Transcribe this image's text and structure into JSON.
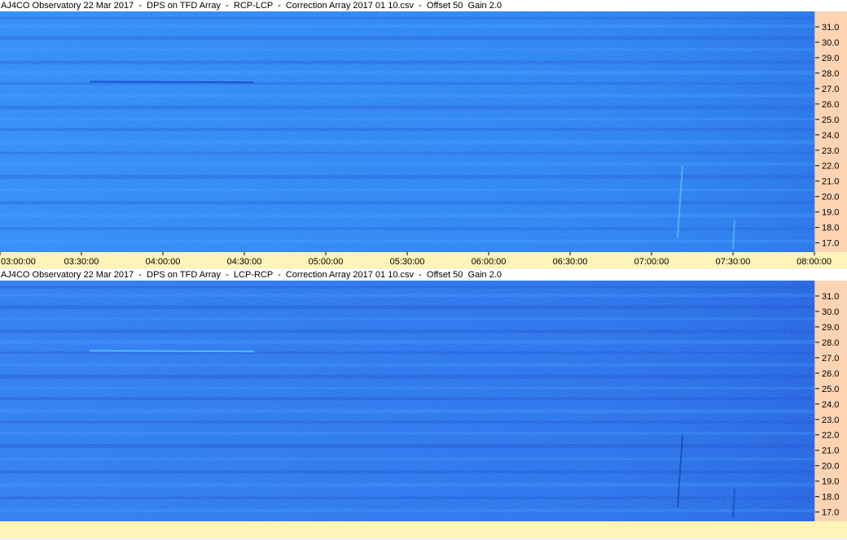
{
  "panels": [
    {
      "title": "AJ4CO Observatory 22 Mar 2017  -  DPS on TFD Array  -  RCP-LCP  -  Correction Array 2017 01 10.csv  -  Offset 50  Gain 2.0",
      "colors": {
        "base": "#1f74ee",
        "light": "#3da2ff",
        "dark": "#1650d6"
      }
    },
    {
      "title": "AJ4CO Observatory 22 Mar 2017  -  DPS on TFD Array  -  LCP-RCP  -  Correction Array 2017 01 10.csv  -  Offset 50  Gain 2.0",
      "colors": {
        "base": "#1c5fe6",
        "light": "#3a98ff",
        "dark": "#1442c8"
      }
    }
  ],
  "chart_data": [
    {
      "type": "heatmap",
      "title": "AJ4CO Observatory 22 Mar 2017  -  DPS on TFD Array  -  RCP-LCP  -  Correction Array 2017 01 10.csv  -  Offset 50  Gain 2.0",
      "xlabel": "",
      "ylabel": "",
      "x_ticks": [
        "03:00:00",
        "03:30:00",
        "04:00:00",
        "04:30:00",
        "05:00:00",
        "05:30:00",
        "06:00:00",
        "06:30:00",
        "07:00:00",
        "07:30:00",
        "08:00:00"
      ],
      "y_ticks": [
        "31.0",
        "30.0",
        "29.0",
        "28.0",
        "27.0",
        "26.0",
        "25.0",
        "24.0",
        "23.0",
        "22.0",
        "21.0",
        "20.0",
        "19.0",
        "18.0",
        "17.0"
      ],
      "xlim": [
        "03:00:00",
        "08:00:00"
      ],
      "ylim": [
        16.4,
        32.0
      ],
      "y_axis_position": "right",
      "colormap": "blue"
    },
    {
      "type": "heatmap",
      "title": "AJ4CO Observatory 22 Mar 2017  -  DPS on TFD Array  -  LCP-RCP  -  Correction Array 2017 01 10.csv  -  Offset 50  Gain 2.0",
      "xlabel": "",
      "ylabel": "",
      "x_ticks": [],
      "y_ticks": [
        "31.0",
        "30.0",
        "29.0",
        "28.0",
        "27.0",
        "26.0",
        "25.0",
        "24.0",
        "23.0",
        "22.0",
        "21.0",
        "20.0",
        "19.0",
        "18.0",
        "17.0"
      ],
      "xlim": [
        "03:00:00",
        "08:00:00"
      ],
      "ylim": [
        16.4,
        32.0
      ],
      "y_axis_position": "right",
      "colormap": "blue"
    }
  ]
}
